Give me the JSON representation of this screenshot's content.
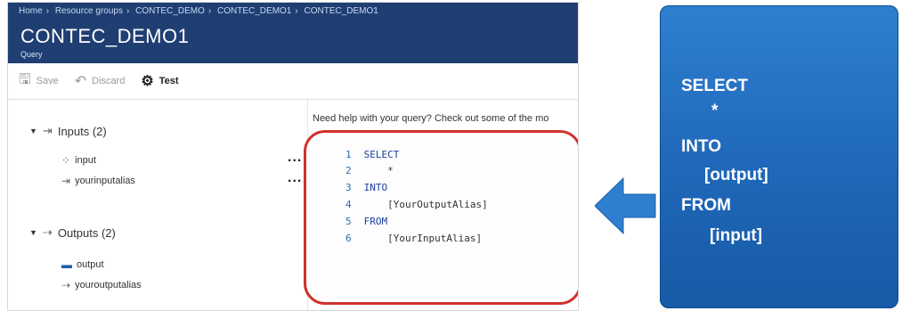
{
  "breadcrumb": [
    "Home",
    "Resource groups",
    "CONTEC_DEMO",
    "CONTEC_DEMO1",
    "CONTEC_DEMO1"
  ],
  "header": {
    "title": "CONTEC_DEMO1",
    "subtitle": "Query"
  },
  "toolbar": {
    "save_label": "Save",
    "discard_label": "Discard",
    "test_label": "Test"
  },
  "inputs": {
    "label": "Inputs (2)",
    "items": [
      "input",
      "yourinputalias"
    ]
  },
  "outputs": {
    "label": "Outputs (2)",
    "items": [
      "output",
      "youroutputalias"
    ]
  },
  "more_dots": "...",
  "help_text": "Need help with your query? Check out some of the mo",
  "code": [
    {
      "n": "1",
      "text": "SELECT"
    },
    {
      "n": "2",
      "text": "    *"
    },
    {
      "n": "3",
      "text": "INTO"
    },
    {
      "n": "4",
      "text": "    [YourOutputAlias]"
    },
    {
      "n": "5",
      "text": "FROM"
    },
    {
      "n": "6",
      "text": "    [YourInputAlias]"
    }
  ],
  "card": [
    "SELECT",
    "*",
    "INTO",
    "[output]",
    "FROM",
    "[input]"
  ],
  "colors": {
    "header_bg": "#1f3f73",
    "highlight": "#d0312d",
    "card_bg": "#2169b9",
    "arrow": "#2f7fd0"
  },
  "icons": {
    "save": "save-icon",
    "discard": "discard-icon",
    "test": "gear-icon"
  }
}
